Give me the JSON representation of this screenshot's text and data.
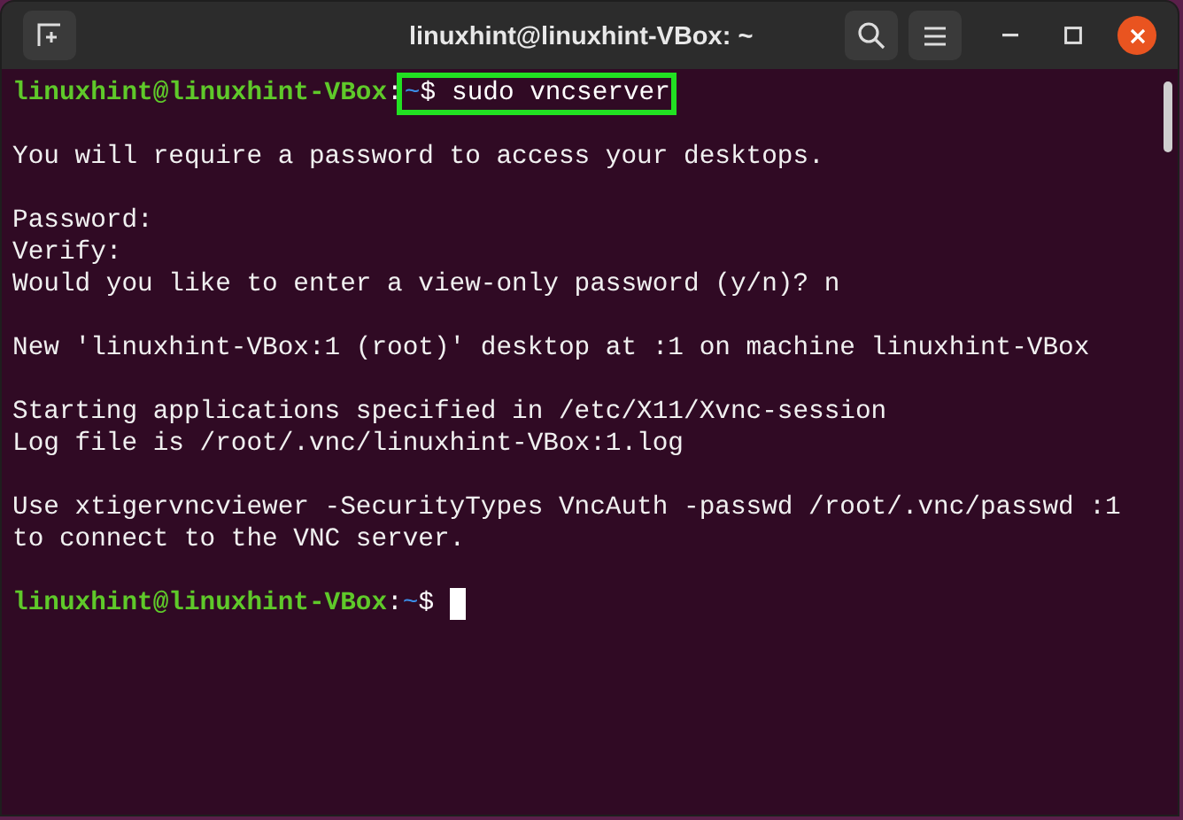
{
  "window": {
    "title": "linuxhint@linuxhint-VBox: ~"
  },
  "terminal": {
    "lines": [
      {
        "kind": "prompt",
        "user_host": "linuxhint@linuxhint-VBox",
        "separator": ":",
        "path": "~",
        "symbol": "$",
        "command": "sudo vncserver",
        "highlighted": true,
        "cursor": false
      },
      {
        "kind": "blank"
      },
      {
        "kind": "output",
        "text": "You will require a password to access your desktops."
      },
      {
        "kind": "blank"
      },
      {
        "kind": "output",
        "text": "Password:"
      },
      {
        "kind": "output",
        "text": "Verify:"
      },
      {
        "kind": "output",
        "text": "Would you like to enter a view-only password (y/n)? n"
      },
      {
        "kind": "blank"
      },
      {
        "kind": "output",
        "text": "New 'linuxhint-VBox:1 (root)' desktop at :1 on machine linuxhint-VBox"
      },
      {
        "kind": "blank"
      },
      {
        "kind": "output",
        "text": "Starting applications specified in /etc/X11/Xvnc-session"
      },
      {
        "kind": "output",
        "text": "Log file is /root/.vnc/linuxhint-VBox:1.log"
      },
      {
        "kind": "blank"
      },
      {
        "kind": "output",
        "text": "Use xtigervncviewer -SecurityTypes VncAuth -passwd /root/.vnc/passwd :1"
      },
      {
        "kind": "output",
        "text": "to connect to the VNC server."
      },
      {
        "kind": "blank"
      },
      {
        "kind": "prompt",
        "user_host": "linuxhint@linuxhint-VBox",
        "separator": ":",
        "path": "~",
        "symbol": "$",
        "highlighted": false,
        "cursor": true
      }
    ]
  }
}
